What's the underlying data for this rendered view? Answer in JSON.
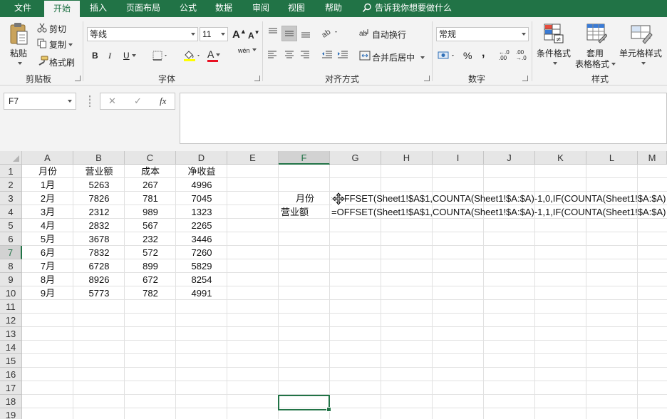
{
  "tabs": [
    {
      "label": "文件",
      "active": false
    },
    {
      "label": "开始",
      "active": true
    },
    {
      "label": "插入",
      "active": false
    },
    {
      "label": "页面布局",
      "active": false
    },
    {
      "label": "公式",
      "active": false
    },
    {
      "label": "数据",
      "active": false
    },
    {
      "label": "审阅",
      "active": false
    },
    {
      "label": "视图",
      "active": false
    },
    {
      "label": "帮助",
      "active": false
    }
  ],
  "tell_me": "告诉我你想要做什么",
  "ribbon": {
    "clipboard": {
      "paste": "粘贴",
      "cut": "剪切",
      "copy": "复制",
      "format_painter": "格式刷",
      "label": "剪贴板"
    },
    "font": {
      "name": "等线",
      "size": "11",
      "bold": "B",
      "italic": "I",
      "underline": "U",
      "grow": "A",
      "shrink": "A",
      "font_color_letter": "A",
      "phonetic": "wén",
      "label": "字体"
    },
    "alignment": {
      "wrap_text": "自动换行",
      "merge_center": "合并后居中",
      "label": "对齐方式"
    },
    "number": {
      "format": "常规",
      "percent": "%",
      "comma": ",",
      "inc_decimal": "←.0 .00",
      "dec_decimal": ".00 →.0",
      "label": "数字"
    },
    "styles": {
      "conditional": "条件格式",
      "table_format_1": "套用",
      "table_format_2": "表格格式",
      "cell_styles": "单元格样式",
      "label": "样式"
    }
  },
  "formula_bar": {
    "name_box": "F7",
    "cancel": "✕",
    "enter": "✓",
    "fx": "fx",
    "content": ""
  },
  "grid": {
    "columns": [
      "A",
      "B",
      "C",
      "D",
      "E",
      "F",
      "G",
      "H",
      "I",
      "J",
      "K",
      "L",
      "M"
    ],
    "rows": [
      "1",
      "2",
      "3",
      "4",
      "5",
      "6",
      "7",
      "8",
      "9",
      "10",
      "11",
      "12",
      "13",
      "14",
      "15",
      "16",
      "17",
      "18",
      "19"
    ],
    "selected_cell": "F7",
    "table": {
      "headers": [
        "月份",
        "营业额",
        "成本",
        "净收益"
      ],
      "rows": [
        [
          "1月",
          "5263",
          "267",
          "4996"
        ],
        [
          "2月",
          "7826",
          "781",
          "7045"
        ],
        [
          "3月",
          "2312",
          "989",
          "1323"
        ],
        [
          "4月",
          "2832",
          "567",
          "2265"
        ],
        [
          "5月",
          "3678",
          "232",
          "3446"
        ],
        [
          "6月",
          "7832",
          "572",
          "7260"
        ],
        [
          "7月",
          "6728",
          "899",
          "5829"
        ],
        [
          "8月",
          "8926",
          "672",
          "8254"
        ],
        [
          "9月",
          "5773",
          "782",
          "4991"
        ]
      ]
    },
    "side": {
      "f3": "月份",
      "f4": "营业额",
      "g3": "=OFFSET(Sheet1!$A$1,COUNTA(Sheet1!$A:$A)-1,0,IF(COUNTA(Sheet1!$A:$A)",
      "g4": "=OFFSET(Sheet1!$A$1,COUNTA(Sheet1!$A:$A)-1,1,IF(COUNTA(Sheet1!$A:$A)"
    }
  },
  "colors": {
    "accent": "#217346",
    "ribbon_bg": "#f3f3f3",
    "header_bg": "#e6e6e6",
    "gridline": "#e1e1e1"
  }
}
